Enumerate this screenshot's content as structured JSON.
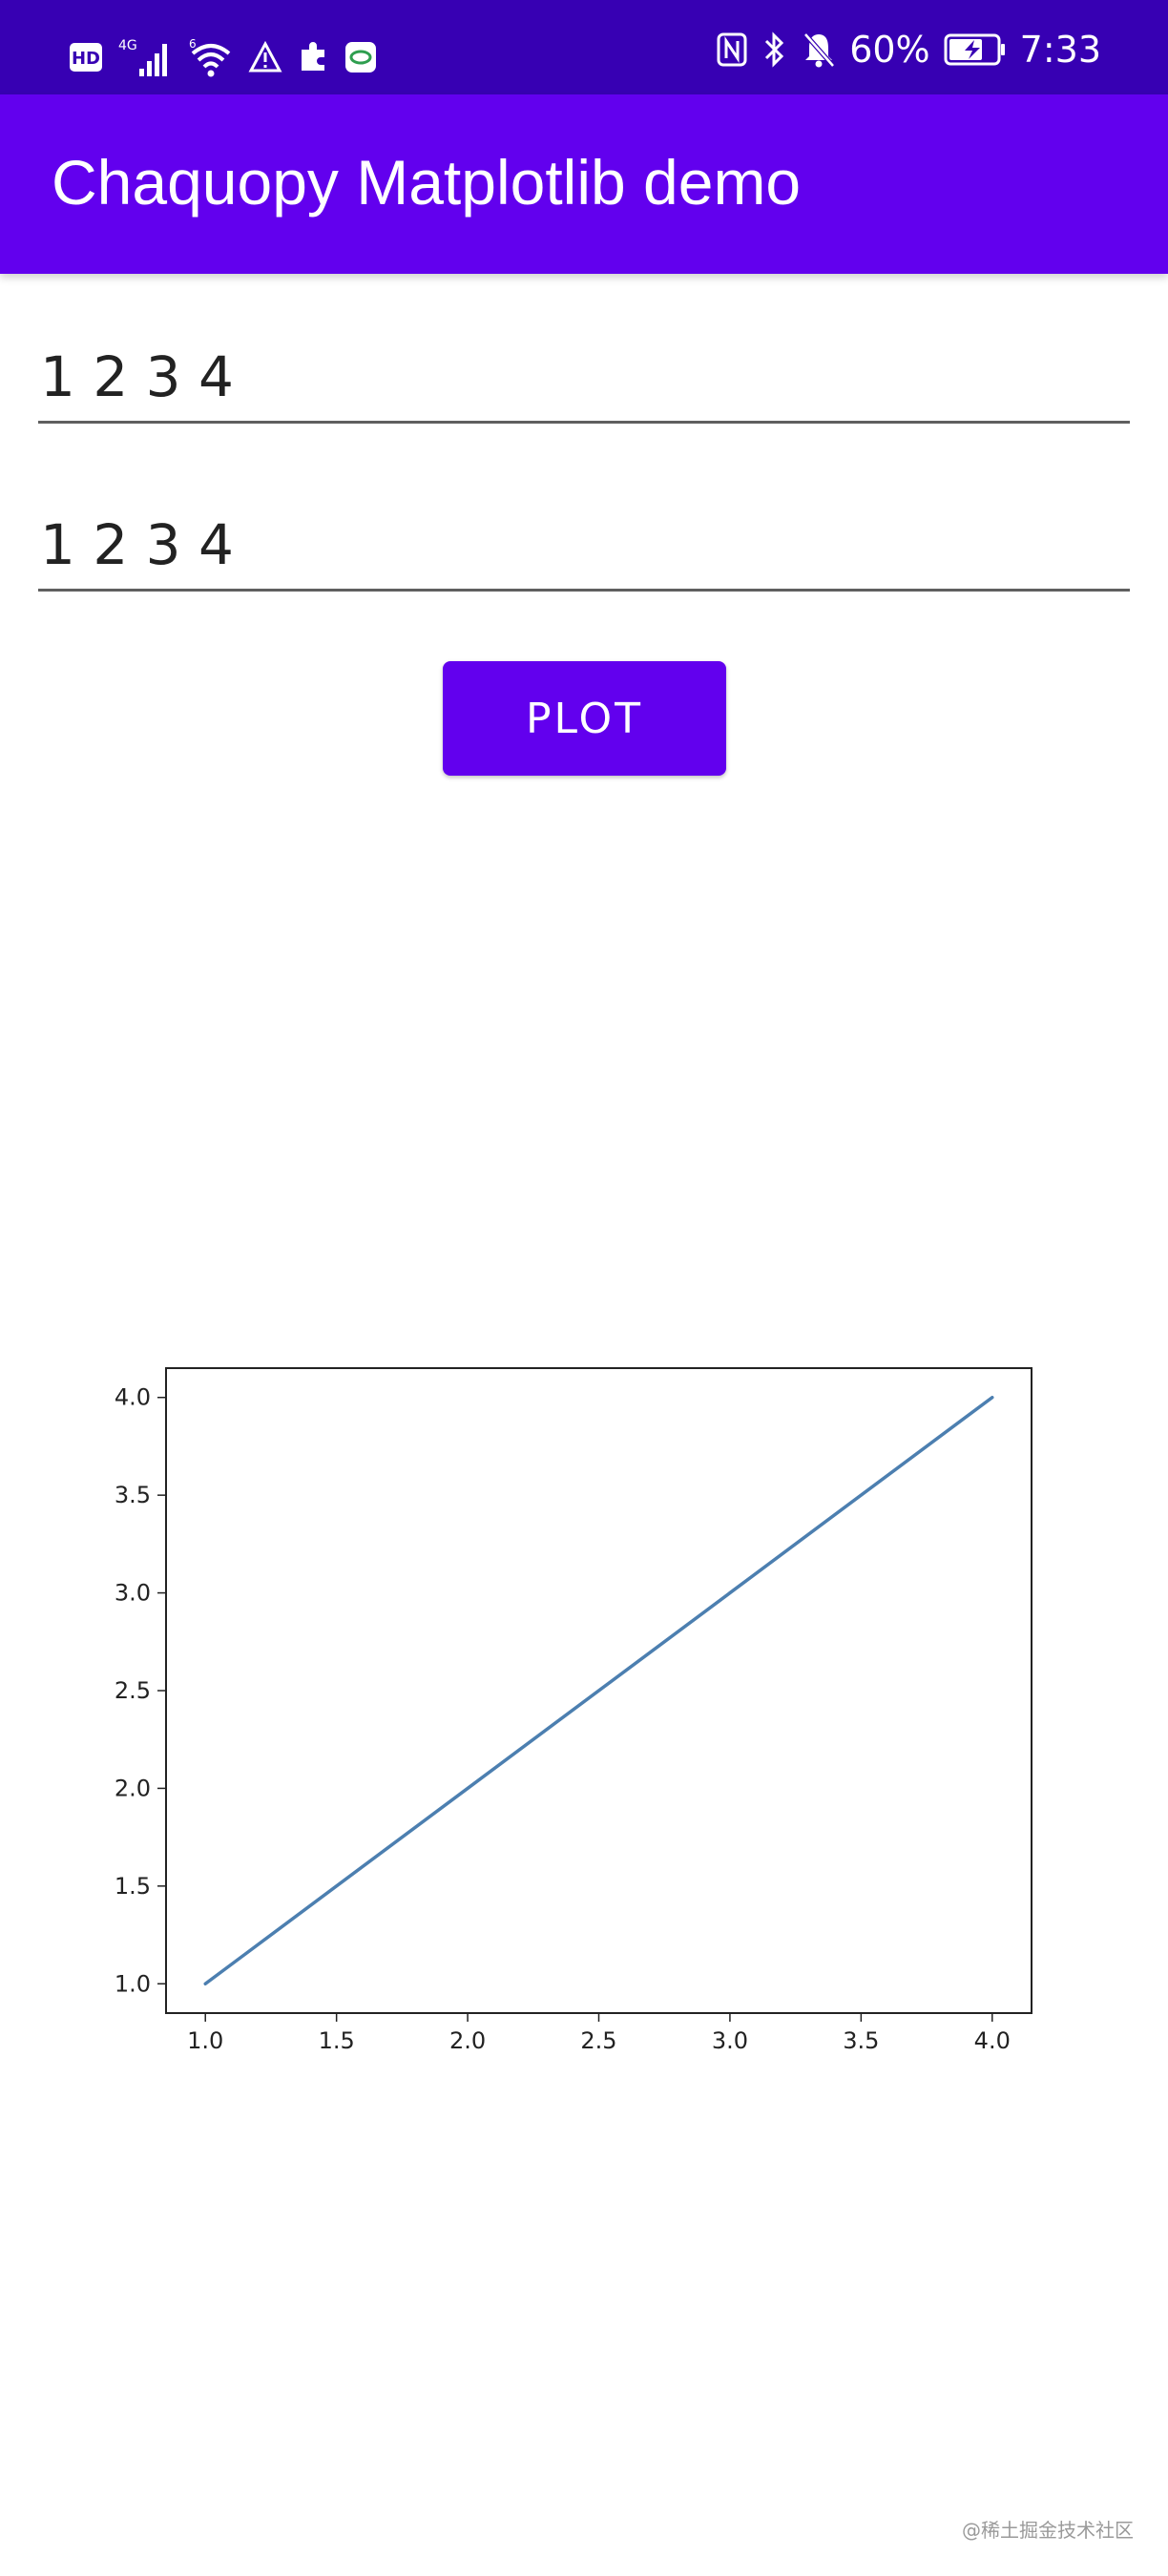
{
  "status_bar": {
    "hd_label": "HD",
    "network_label": "4G",
    "wifi_label": "6",
    "battery_percent": "60%",
    "time": "7:33",
    "icons": [
      "hd-icon",
      "signal-icon",
      "wifi-icon",
      "warning-icon",
      "puzzle-icon",
      "app-icon",
      "nfc-icon",
      "bluetooth-icon",
      "bell-off-icon",
      "battery-icon"
    ]
  },
  "app_bar": {
    "title": "Chaquopy Matplotlib demo",
    "color": "#6200ee"
  },
  "form": {
    "x_value": "1 2 3 4",
    "y_value": "1 2 3 4",
    "plot_button_label": "PLOT"
  },
  "chart_data": {
    "type": "line",
    "x": [
      1,
      2,
      3,
      4
    ],
    "series": [
      {
        "values": [
          1,
          2,
          3,
          4
        ],
        "color": "#4c7fb0"
      }
    ],
    "xlim": [
      0.85,
      4.15
    ],
    "ylim": [
      0.85,
      4.15
    ],
    "xticks": [
      "1.0",
      "1.5",
      "2.0",
      "2.5",
      "3.0",
      "3.5",
      "4.0"
    ],
    "yticks": [
      "1.0",
      "1.5",
      "2.0",
      "2.5",
      "3.0",
      "3.5",
      "4.0"
    ],
    "title": "",
    "xlabel": "",
    "ylabel": "",
    "grid": false
  },
  "watermark": "@稀土掘金技术社区"
}
